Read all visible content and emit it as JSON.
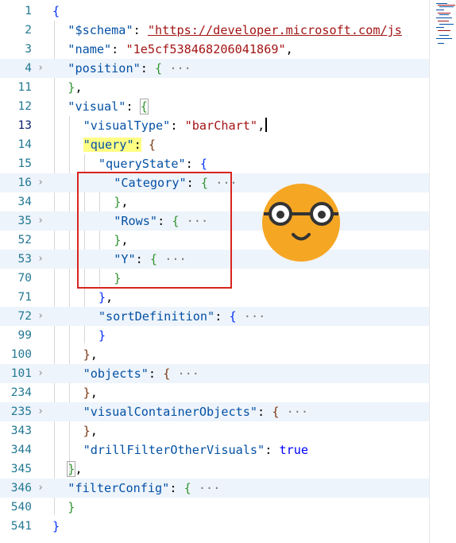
{
  "editor": {
    "active_line": "13",
    "lines": [
      {
        "n": "1",
        "tokens": [
          [
            "{",
            "b1"
          ]
        ]
      },
      {
        "n": "2",
        "tokens": [
          [
            "\"$schema\"",
            "k"
          ],
          [
            ": ",
            "p"
          ],
          [
            "\"https://developer.microsoft.com/js",
            "s link"
          ]
        ]
      },
      {
        "n": "3",
        "tokens": [
          [
            "\"name\"",
            "k"
          ],
          [
            ": ",
            "p"
          ],
          [
            "\"1e5cf538468206041869\"",
            "s"
          ],
          [
            ",",
            "p"
          ]
        ]
      },
      {
        "n": "4",
        "folded": true,
        "tokens": [
          [
            "\"position\"",
            "k"
          ],
          [
            ": ",
            "p"
          ],
          [
            "{",
            "b2"
          ],
          [
            " ···",
            "dots"
          ]
        ]
      },
      {
        "n": "11",
        "tokens": [
          [
            "}",
            "b2"
          ],
          [
            ",",
            "p"
          ]
        ]
      },
      {
        "n": "12",
        "tokens": [
          [
            "\"visual\"",
            "k"
          ],
          [
            ": ",
            "p"
          ],
          [
            "{",
            "b2 bm"
          ]
        ]
      },
      {
        "n": "13",
        "active": true,
        "tokens": [
          [
            "\"visualType\"",
            "k"
          ],
          [
            ": ",
            "p"
          ],
          [
            "\"barChart\"",
            "s"
          ],
          [
            ",",
            "p"
          ]
        ]
      },
      {
        "n": "14",
        "tokens": [
          [
            "\"query\"",
            "k hl"
          ],
          [
            ":",
            "p hl"
          ],
          [
            " ",
            "p"
          ],
          [
            "{",
            "b3"
          ]
        ]
      },
      {
        "n": "15",
        "tokens": [
          [
            "\"queryState\"",
            "k"
          ],
          [
            ": ",
            "p"
          ],
          [
            "{",
            "b1"
          ]
        ]
      },
      {
        "n": "16",
        "folded": true,
        "tokens": [
          [
            "\"Category\"",
            "k"
          ],
          [
            ": ",
            "p"
          ],
          [
            "{",
            "b2"
          ],
          [
            " ···",
            "dots"
          ]
        ]
      },
      {
        "n": "34",
        "tokens": [
          [
            "}",
            "b2"
          ],
          [
            ",",
            "p"
          ]
        ]
      },
      {
        "n": "35",
        "folded": true,
        "tokens": [
          [
            "\"Rows\"",
            "k"
          ],
          [
            ": ",
            "p"
          ],
          [
            "{",
            "b2"
          ],
          [
            " ···",
            "dots"
          ]
        ]
      },
      {
        "n": "52",
        "tokens": [
          [
            "}",
            "b2"
          ],
          [
            ",",
            "p"
          ]
        ]
      },
      {
        "n": "53",
        "folded": true,
        "tokens": [
          [
            "\"Y\"",
            "k"
          ],
          [
            ": ",
            "p"
          ],
          [
            "{",
            "b2"
          ],
          [
            " ···",
            "dots"
          ]
        ]
      },
      {
        "n": "70",
        "tokens": [
          [
            "}",
            "b2"
          ]
        ]
      },
      {
        "n": "71",
        "tokens": [
          [
            "}",
            "b1"
          ],
          [
            ",",
            "p"
          ]
        ]
      },
      {
        "n": "72",
        "folded": true,
        "tokens": [
          [
            "\"sortDefinition\"",
            "k"
          ],
          [
            ": ",
            "p"
          ],
          [
            "{",
            "b1"
          ],
          [
            " ···",
            "dots"
          ]
        ]
      },
      {
        "n": "99",
        "tokens": [
          [
            "}",
            "b1"
          ]
        ]
      },
      {
        "n": "100",
        "tokens": [
          [
            "}",
            "b3"
          ],
          [
            ",",
            "p"
          ]
        ]
      },
      {
        "n": "101",
        "folded": true,
        "tokens": [
          [
            "\"objects\"",
            "k"
          ],
          [
            ": ",
            "p"
          ],
          [
            "{",
            "b3"
          ],
          [
            " ···",
            "dots"
          ]
        ]
      },
      {
        "n": "234",
        "tokens": [
          [
            "}",
            "b3"
          ],
          [
            ",",
            "p"
          ]
        ]
      },
      {
        "n": "235",
        "folded": true,
        "tokens": [
          [
            "\"visualContainerObjects\"",
            "k"
          ],
          [
            ": ",
            "p"
          ],
          [
            "{",
            "b3"
          ],
          [
            " ···",
            "dots"
          ]
        ]
      },
      {
        "n": "343",
        "tokens": [
          [
            "}",
            "b3"
          ],
          [
            ",",
            "p"
          ]
        ]
      },
      {
        "n": "344",
        "tokens": [
          [
            "\"drillFilterOtherVisuals\"",
            "k"
          ],
          [
            ": ",
            "p"
          ],
          [
            "true",
            "v"
          ]
        ]
      },
      {
        "n": "345",
        "tokens": [
          [
            "}",
            "b2 bm"
          ],
          [
            ",",
            "p"
          ]
        ]
      },
      {
        "n": "346",
        "folded": true,
        "tokens": [
          [
            "\"filterConfig\"",
            "k"
          ],
          [
            ": ",
            "p"
          ],
          [
            "{",
            "b2"
          ],
          [
            " ···",
            "dots"
          ]
        ]
      },
      {
        "n": "540",
        "tokens": [
          [
            "}",
            "b2"
          ]
        ]
      },
      {
        "n": "541",
        "tokens": [
          [
            "}",
            "b1"
          ]
        ]
      }
    ]
  },
  "colors": {
    "key": "#0451a5",
    "string": "#a31515",
    "keyword": "#0000ff",
    "line_number": "#237893",
    "fold_background": "#eef4fb",
    "highlight": "#ffff84",
    "annotation_box": "#d9241e",
    "emoji_face": "#f5a623"
  },
  "icons": {
    "fold_chevron": "chevron-right-icon",
    "emoji": "nerd-face-emoji-icon"
  }
}
